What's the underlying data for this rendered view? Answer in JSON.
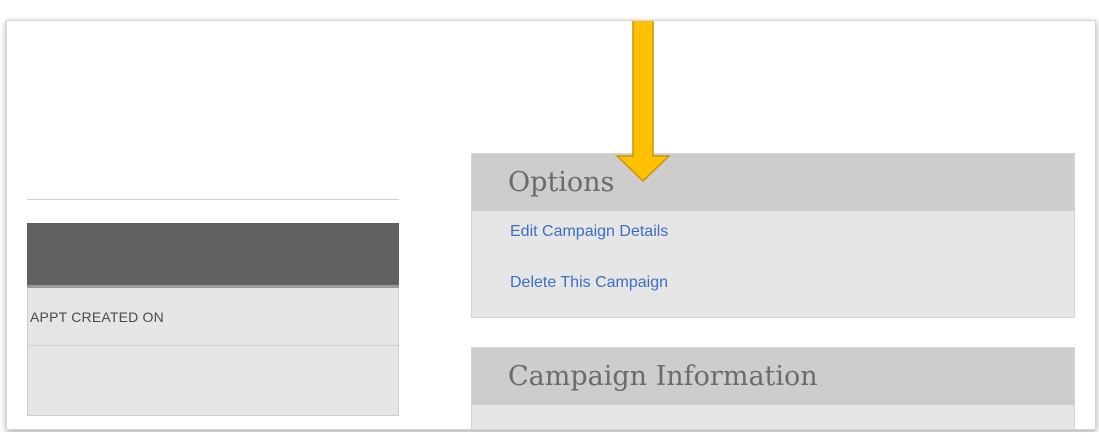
{
  "left_table": {
    "header_label": "",
    "rows": [
      "APPT CREATED ON",
      ""
    ]
  },
  "options_panel": {
    "title": "Options",
    "links": [
      "Edit Campaign Details",
      "Delete This Campaign"
    ]
  },
  "info_panel": {
    "title": "Campaign Information"
  },
  "colors": {
    "link": "#3b6fc4",
    "arrow_fill": "#ffc000",
    "arrow_stroke": "#c8950a",
    "table_header": "#616161",
    "panel_header": "#cdcdcd",
    "panel_body": "#e6e6e6"
  },
  "annotation": {
    "icon": "down-arrow-icon"
  }
}
